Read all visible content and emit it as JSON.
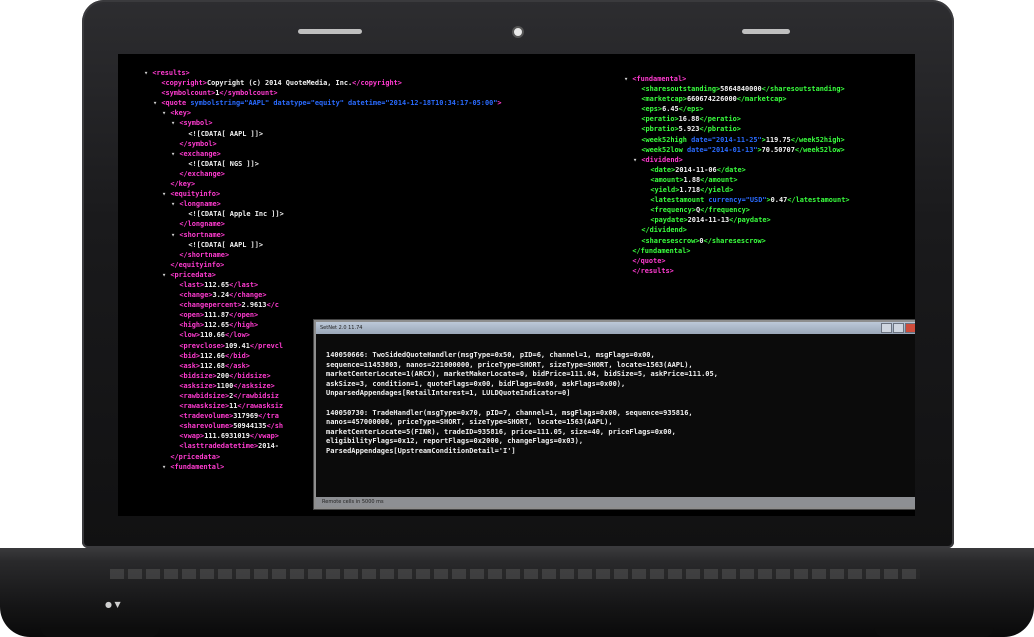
{
  "left_xml": [
    {
      "indent": 0,
      "tri": "▾",
      "html": "tag:<results>"
    },
    {
      "indent": 1,
      "tri": "",
      "html": "tag:<copyright>|txt:Copyright (c) 2014 QuoteMedia, Inc.|tag:</copyright>"
    },
    {
      "indent": 1,
      "tri": "",
      "html": "tag:<symbolcount>|txt:1|tag:</symbolcount>"
    },
    {
      "indent": 1,
      "tri": "▾",
      "html": "tag:<quote |attr:symbolstring=|val:\"AAPL\" |attr:datatype=|val:\"equity\" |attr:datetime=|val:\"2014-12-18T10:34:17-05:00\"|tag:>"
    },
    {
      "indent": 2,
      "tri": "▾",
      "html": "tag:<key>"
    },
    {
      "indent": 3,
      "tri": "▾",
      "html": "tag:<symbol>"
    },
    {
      "indent": 4,
      "tri": "",
      "html": "txt:<![CDATA[ AAPL ]]>"
    },
    {
      "indent": 3,
      "tri": "",
      "html": "tag:</symbol>"
    },
    {
      "indent": 3,
      "tri": "▾",
      "html": "tag:<exchange>"
    },
    {
      "indent": 4,
      "tri": "",
      "html": "txt:<![CDATA[ NGS ]]>"
    },
    {
      "indent": 3,
      "tri": "",
      "html": "tag:</exchange>"
    },
    {
      "indent": 2,
      "tri": "",
      "html": "tag:</key>"
    },
    {
      "indent": 2,
      "tri": "▾",
      "html": "tag:<equityinfo>"
    },
    {
      "indent": 3,
      "tri": "▾",
      "html": "tag:<longname>"
    },
    {
      "indent": 4,
      "tri": "",
      "html": "txt:<![CDATA[ Apple Inc ]]>"
    },
    {
      "indent": 3,
      "tri": "",
      "html": "tag:</longname>"
    },
    {
      "indent": 3,
      "tri": "▾",
      "html": "tag:<shortname>"
    },
    {
      "indent": 4,
      "tri": "",
      "html": "txt:<![CDATA[ AAPL ]]>"
    },
    {
      "indent": 3,
      "tri": "",
      "html": "tag:</shortname>"
    },
    {
      "indent": 2,
      "tri": "",
      "html": "tag:</equityinfo>"
    },
    {
      "indent": 2,
      "tri": "▾",
      "html": "tag:<pricedata>"
    },
    {
      "indent": 3,
      "tri": "",
      "html": "tag:<last>|txt:112.65|tag:</last>"
    },
    {
      "indent": 3,
      "tri": "",
      "html": "tag:<change>|txt:3.24|tag:</change>"
    },
    {
      "indent": 3,
      "tri": "",
      "html": "tag:<changepercent>|txt:2.9613|tag:</c"
    },
    {
      "indent": 3,
      "tri": "",
      "html": "tag:<open>|txt:111.87|tag:</open>"
    },
    {
      "indent": 3,
      "tri": "",
      "html": "tag:<high>|txt:112.65|tag:</high>"
    },
    {
      "indent": 3,
      "tri": "",
      "html": "tag:<low>|txt:110.66|tag:</low>"
    },
    {
      "indent": 3,
      "tri": "",
      "html": "tag:<prevclose>|txt:109.41|tag:</prevcl"
    },
    {
      "indent": 3,
      "tri": "",
      "html": "tag:<bid>|txt:112.66|tag:</bid>"
    },
    {
      "indent": 3,
      "tri": "",
      "html": "tag:<ask>|txt:112.68|tag:</ask>"
    },
    {
      "indent": 3,
      "tri": "",
      "html": "tag:<bidsize>|txt:200|tag:</bidsize>"
    },
    {
      "indent": 3,
      "tri": "",
      "html": "tag:<asksize>|txt:1100|tag:</asksize>"
    },
    {
      "indent": 3,
      "tri": "",
      "html": "tag:<rawbidsize>|txt:2|tag:</rawbidsiz"
    },
    {
      "indent": 3,
      "tri": "",
      "html": "tag:<rawasksize>|txt:11|tag:</rawasksiz"
    },
    {
      "indent": 3,
      "tri": "",
      "html": "tag:<tradevolume>|txt:317969|tag:</tra"
    },
    {
      "indent": 3,
      "tri": "",
      "html": "tag:<sharevolume>|txt:50944135|tag:</sh"
    },
    {
      "indent": 3,
      "tri": "",
      "html": "tag:<vwap>|txt:111.6931019|tag:</vwap>"
    },
    {
      "indent": 3,
      "tri": "",
      "html": "tag:<lasttradedatetime>|txt:2014-"
    },
    {
      "indent": 2,
      "tri": "",
      "html": "tag:</pricedata>"
    },
    {
      "indent": 2,
      "tri": "▾",
      "html": "tag:<fundamental>"
    }
  ],
  "right_xml": [
    {
      "indent": 0,
      "tri": "▾",
      "html": "tag:<fundamental>"
    },
    {
      "indent": 1,
      "tri": "",
      "html": "g:<sharesoutstanding>|txt:5864840000|g:</sharesoutstanding>"
    },
    {
      "indent": 1,
      "tri": "",
      "html": "g:<marketcap>|txt:660674226000|g:</marketcap>"
    },
    {
      "indent": 1,
      "tri": "",
      "html": "g:<eps>|txt:6.45|g:</eps>"
    },
    {
      "indent": 1,
      "tri": "",
      "html": "g:<peratio>|txt:16.88|g:</peratio>"
    },
    {
      "indent": 1,
      "tri": "",
      "html": "g:<pbratio>|txt:5.923|g:</pbratio>"
    },
    {
      "indent": 1,
      "tri": "",
      "html": "g:<week52high |attr:date=|val:\"2014-11-25\"|g:>|txt:119.75|g:</week52high>"
    },
    {
      "indent": 1,
      "tri": "",
      "html": "g:<week52low |attr:date=|val:\"2014-01-13\"|g:>|txt:70.50707|g:</week52low>"
    },
    {
      "indent": 1,
      "tri": "▾",
      "html": "tag:<dividend>"
    },
    {
      "indent": 2,
      "tri": "",
      "html": "g:<date>|txt:2014-11-06|g:</date>"
    },
    {
      "indent": 2,
      "tri": "",
      "html": "g:<amount>|txt:1.88|g:</amount>"
    },
    {
      "indent": 2,
      "tri": "",
      "html": "g:<yield>|txt:1.718|g:</yield>"
    },
    {
      "indent": 2,
      "tri": "",
      "html": "g:<latestamount |attr:currency=|val:\"USD\"|g:>|txt:0.47|g:</latestamount>"
    },
    {
      "indent": 2,
      "tri": "",
      "html": "g:<frequency>|txt:Q|g:</frequency>"
    },
    {
      "indent": 2,
      "tri": "",
      "html": "g:<paydate>|txt:2014-11-13|g:</paydate>"
    },
    {
      "indent": 1,
      "tri": "",
      "html": "g:</dividend>"
    },
    {
      "indent": 1,
      "tri": "",
      "html": "g:<sharesescrow>|txt:0|g:</sharesescrow>"
    },
    {
      "indent": 0,
      "tri": "",
      "html": "g:</fundamental>"
    },
    {
      "indent": 0,
      "tri": "",
      "html": "tag:</quote>"
    },
    {
      "indent": 0,
      "tri": "",
      "html": "tag:</results>"
    }
  ],
  "terminal": {
    "title": "SetNet 2.0 11.74",
    "status": "Remote cells in 5000 ms",
    "lines": [
      "140050666: TwoSidedQuoteHandler(msgType=0x50, pID=6, channel=1, msgFlags=0x00,",
      "sequence=11453803, nanos=221000000, priceType=SHORT, sizeType=SHORT, locate=1563(AAPL),",
      "marketCenterLocate=1(ARCX), marketMakerLocate=0, bidPrice=111.04, bidSize=5, askPrice=111.05,",
      "askSize=3, condition=1, quoteFlags=0x00, bidFlags=0x00, askFlags=0x00),",
      "UnparsedAppendages[RetailInterest=1, LULDQuoteIndicator=0]",
      "",
      "140050730: TradeHandler(msgType=0x70, pID=7, channel=1, msgFlags=0x00, sequence=935816,",
      "nanos=457000000, priceType=SHORT, sizeType=SHORT, locate=1563(AAPL),",
      "marketCenterLocate=5(FINR), tradeID=935816, price=111.05, size=40, priceFlags=0x00,",
      "eligibilityFlags=0x12, reportFlags=0x2000, changeFlags=0x03),",
      "ParsedAppendages[UpstreamConditionDetail='I']"
    ]
  },
  "leds": "● ▼"
}
